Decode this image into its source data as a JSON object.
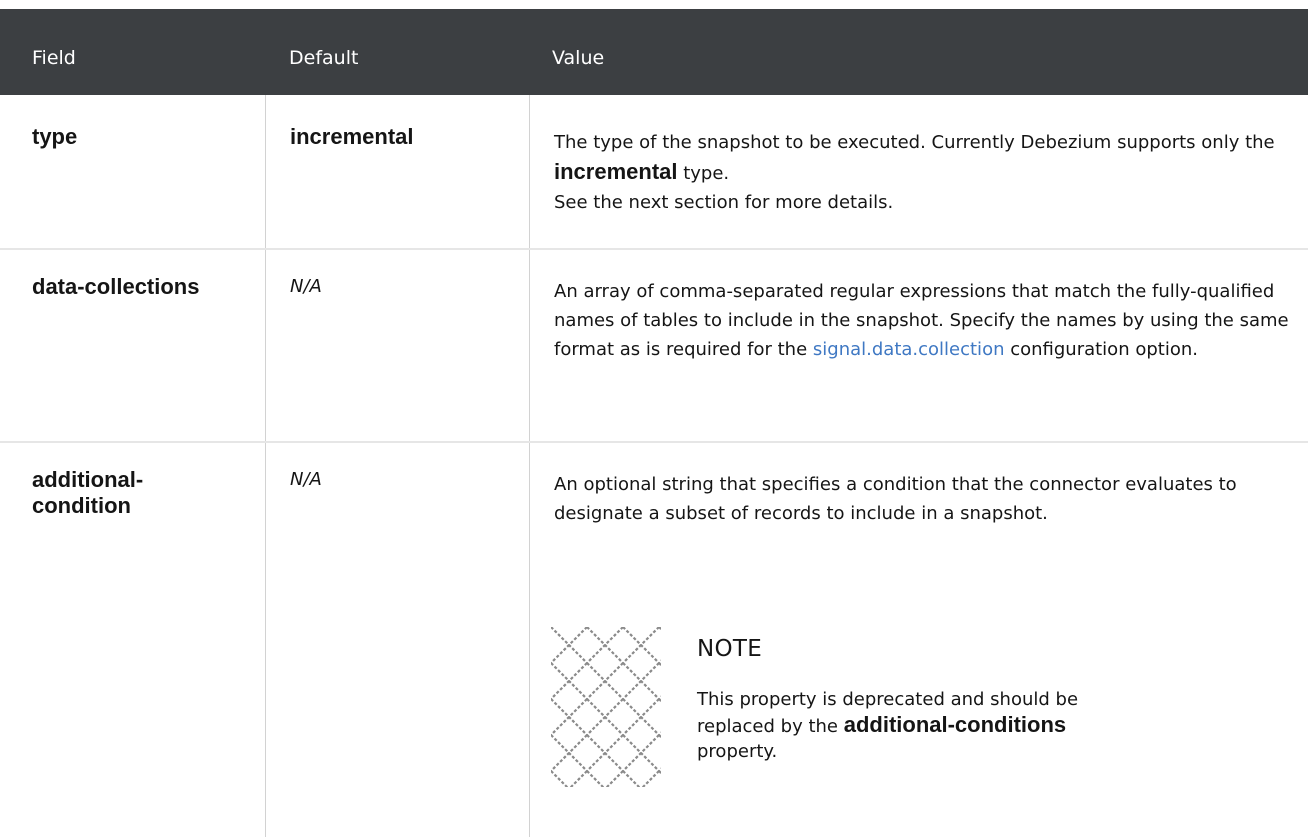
{
  "header": {
    "col_field": "Field",
    "col_default": "Default",
    "col_value": "Value"
  },
  "rows": [
    {
      "field": "type",
      "default": "incremental",
      "value_parts": [
        "The type of the snapshot to be executed. Currently Debezium supports only the ",
        "incremental",
        " type.",
        "See the next section for more details."
      ]
    },
    {
      "field": "data-collections",
      "default": "N/A",
      "value_parts": [
        "An array of comma-separated regular expressions that match the fully-qualified names of tables to include in the snapshot. Specify the names by using the same format as is required for the ",
        "signal.data.collection",
        " configuration option."
      ]
    },
    {
      "field": "additional-condition",
      "default": "N/A",
      "value_parts": [
        "An optional string that specifies a condition that the connector evaluates to designate a subset of records to include in a snapshot."
      ]
    }
  ],
  "note": {
    "icon": "note-pattern-icon",
    "title": "NOTE",
    "text_parts": [
      "This property is deprecated and should be replaced by the ",
      "additional-conditions",
      " property."
    ]
  },
  "colors": {
    "header_bg": "#3c3f42",
    "header_text": "#ffffff",
    "link": "#3f78c3",
    "grid_line": "#d2d2d2"
  }
}
